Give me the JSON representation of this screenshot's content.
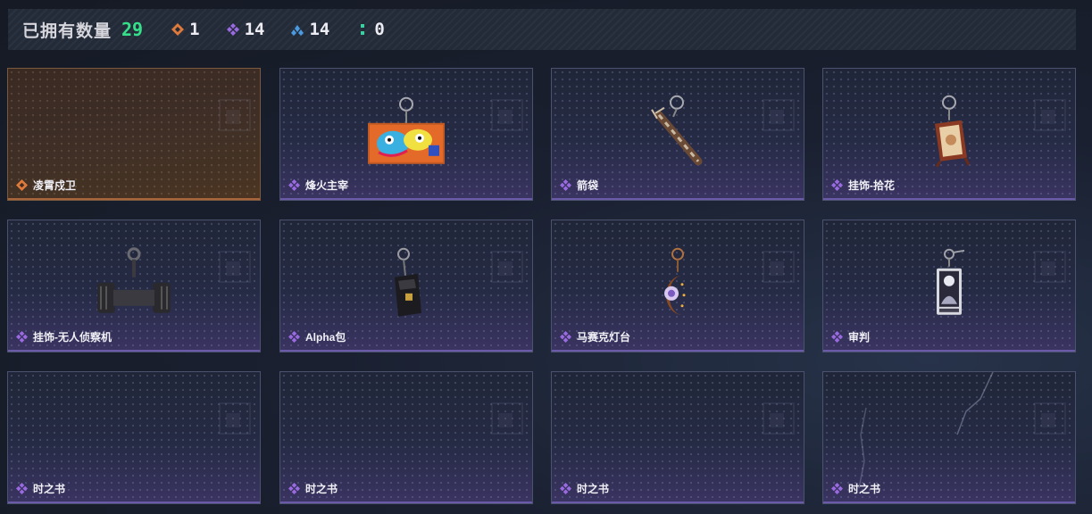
{
  "header": {
    "owned_label": "已拥有数量",
    "owned_count": "29",
    "stats": [
      {
        "icon": "orange-rarity-icon",
        "color": "#e07a3a",
        "value": "1"
      },
      {
        "icon": "purple-rarity-icon",
        "color": "#9a6ae0",
        "value": "14"
      },
      {
        "icon": "blue-rarity-icon",
        "color": "#4a9ae0",
        "value": "14"
      },
      {
        "icon": "green-rarity-icon",
        "color": "#3ad0a0",
        "value": "0"
      }
    ]
  },
  "colors": {
    "owned_count": "#35e08a",
    "purple_rarity": "#9a6ae0",
    "orange_rarity": "#e07a3a"
  },
  "items": [
    {
      "name": "凌霄戍卫",
      "rarity": "orange",
      "art": "none"
    },
    {
      "name": "烽火主宰",
      "rarity": "purple",
      "art": "graffiti-pendant"
    },
    {
      "name": "箭袋",
      "rarity": "purple",
      "art": "quiver-pendant"
    },
    {
      "name": "挂饰-拾花",
      "rarity": "purple",
      "art": "frame-pendant"
    },
    {
      "name": "挂饰-无人侦察机",
      "rarity": "purple",
      "art": "drone-pendant"
    },
    {
      "name": "Alpha包",
      "rarity": "purple",
      "art": "bag-pendant"
    },
    {
      "name": "马赛克灯台",
      "rarity": "purple",
      "art": "lamp-pendant"
    },
    {
      "name": "审判",
      "rarity": "purple",
      "art": "card-pendant"
    },
    {
      "name": "时之书",
      "rarity": "purple",
      "art": "none"
    },
    {
      "name": "时之书",
      "rarity": "purple",
      "art": "none"
    },
    {
      "name": "时之书",
      "rarity": "purple",
      "art": "none"
    },
    {
      "name": "时之书",
      "rarity": "purple",
      "art": "none"
    }
  ]
}
